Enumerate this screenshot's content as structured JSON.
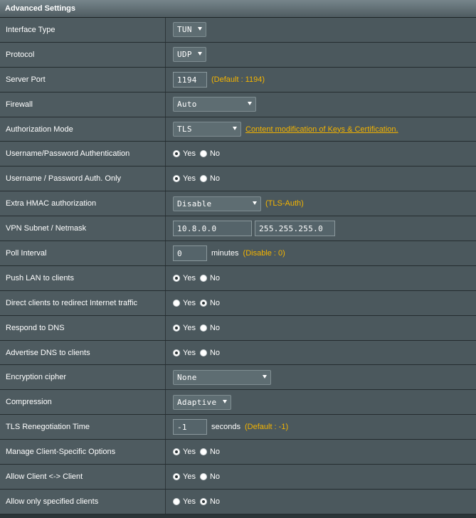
{
  "header": {
    "title": "Advanced Settings"
  },
  "rows": [
    {
      "label": "Interface Type",
      "type": "select",
      "value": "TUN"
    },
    {
      "label": "Protocol",
      "type": "select",
      "value": "UDP"
    },
    {
      "label": "Server Port",
      "type": "input",
      "value": "1194",
      "hint": "(Default : 1194)"
    },
    {
      "label": "Firewall",
      "type": "select",
      "value": "Auto"
    },
    {
      "label": "Authorization Mode",
      "type": "select",
      "value": "TLS",
      "link": "Content modification of Keys & Certification."
    },
    {
      "label": "Username/Password Authentication",
      "type": "radio",
      "yes": "Yes",
      "no": "No",
      "selected": "yes"
    },
    {
      "label": "Username / Password Auth. Only",
      "type": "radio",
      "yes": "Yes",
      "no": "No",
      "selected": "yes"
    },
    {
      "label": "Extra HMAC authorization",
      "type": "select",
      "value": "Disable",
      "hint": "(TLS-Auth)"
    },
    {
      "label": "VPN Subnet / Netmask",
      "type": "dual-input",
      "value": "10.8.0.0",
      "value2": "255.255.255.0"
    },
    {
      "label": "Poll Interval",
      "type": "input",
      "value": "0",
      "unit": "minutes",
      "hint": "(Disable : 0)"
    },
    {
      "label": "Push LAN to clients",
      "type": "radio",
      "yes": "Yes",
      "no": "No",
      "selected": "yes"
    },
    {
      "label": "Direct clients to redirect Internet traffic",
      "type": "radio",
      "yes": "Yes",
      "no": "No",
      "selected": "no"
    },
    {
      "label": "Respond to DNS",
      "type": "radio",
      "yes": "Yes",
      "no": "No",
      "selected": "yes"
    },
    {
      "label": "Advertise DNS to clients",
      "type": "radio",
      "yes": "Yes",
      "no": "No",
      "selected": "yes"
    },
    {
      "label": "Encryption cipher",
      "type": "select",
      "value": "None"
    },
    {
      "label": "Compression",
      "type": "select",
      "value": "Adaptive"
    },
    {
      "label": "TLS Renegotiation Time",
      "type": "input",
      "value": "-1",
      "unit": "seconds",
      "hint": "(Default : -1)"
    },
    {
      "label": "Manage Client-Specific Options",
      "type": "radio",
      "yes": "Yes",
      "no": "No",
      "selected": "yes"
    },
    {
      "label": "Allow Client <-> Client",
      "type": "radio",
      "yes": "Yes",
      "no": "No",
      "selected": "yes"
    },
    {
      "label": "Allow only specified clients",
      "type": "radio",
      "yes": "Yes",
      "no": "No",
      "selected": "no"
    }
  ],
  "colors": {
    "accent": "#f4b400",
    "label_bg": "#4e5b60",
    "value_bg": "#4b585d"
  }
}
